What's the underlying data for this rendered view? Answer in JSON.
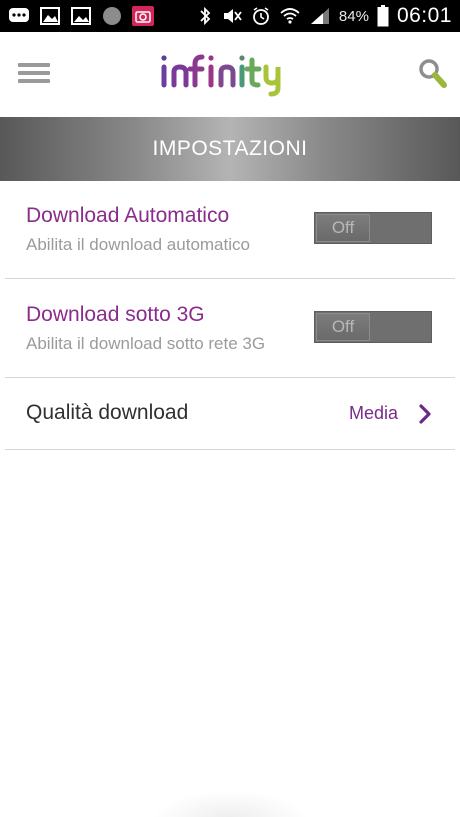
{
  "status_bar": {
    "battery_percent": "84%",
    "time": "06:01",
    "left_icons": [
      "chat-icon",
      "image-icon",
      "gallery-icon",
      "circle-icon",
      "camera-icon"
    ],
    "right_icons": [
      "bluetooth-icon",
      "mute-icon",
      "alarm-icon",
      "wifi-icon",
      "signal-icon",
      "battery-icon"
    ]
  },
  "header": {
    "logo_text": "infinity",
    "menu_icon": "hamburger-menu-icon",
    "search_icon": "search-icon"
  },
  "section": {
    "title": "IMPOSTAZIONI"
  },
  "settings": [
    {
      "title": "Download Automatico",
      "subtitle": "Abilita il download automatico",
      "toggle_label": "Off"
    },
    {
      "title": "Download sotto 3G",
      "subtitle": "Abilita il download sotto rete 3G",
      "toggle_label": "Off"
    }
  ],
  "quality": {
    "title": "Qualità download",
    "value": "Media"
  },
  "colors": {
    "accent_purple": "#8a2c8c",
    "logo_purple": "#7a3e96",
    "logo_green": "#a8c43a",
    "section_gray": "#8a8a8a"
  }
}
